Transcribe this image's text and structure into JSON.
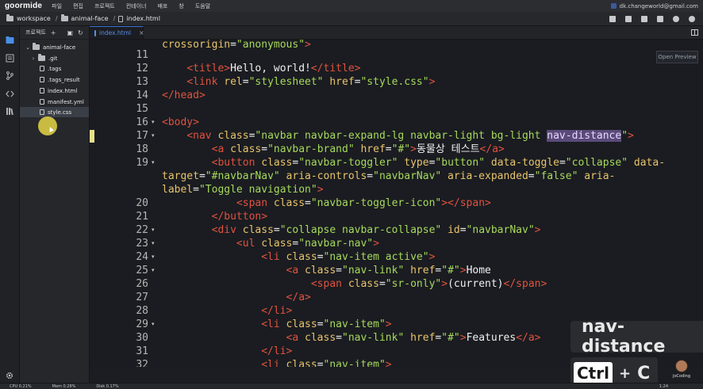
{
  "app": {
    "logo": "goormide",
    "menu": [
      "파일",
      "편집",
      "프로젝트",
      "컨테이너",
      "배포",
      "창",
      "도움말"
    ],
    "account": "dk.changeworld@gmail.com"
  },
  "breadcrumb": [
    "workspace",
    "animal-face",
    "index.html"
  ],
  "explorer": {
    "title": "프로젝트",
    "root": "animal-face",
    "items": [
      ".git",
      ".tags",
      ".tags_result",
      "index.html",
      "manifest.yml",
      "style.css"
    ],
    "selected": "style.css"
  },
  "editor": {
    "tab": "index.html",
    "preview_button": "Open Preview",
    "first_line_fragment": [
      {
        "c": "t-attr",
        "t": "crossorigin"
      },
      {
        "c": "t-text",
        "t": "="
      },
      {
        "c": "t-str",
        "t": "\"anonymous\""
      },
      {
        "c": "t-tag",
        "t": ">"
      }
    ],
    "lines": [
      {
        "n": "11",
        "fold": false,
        "tokens": []
      },
      {
        "n": "12",
        "fold": false,
        "tokens": [
          {
            "c": "t-text",
            "t": "    "
          },
          {
            "c": "t-tag",
            "t": "<title>"
          },
          {
            "c": "t-text",
            "t": "Hello, world!"
          },
          {
            "c": "t-tag",
            "t": "</title>"
          }
        ]
      },
      {
        "n": "13",
        "fold": false,
        "tokens": [
          {
            "c": "t-text",
            "t": "    "
          },
          {
            "c": "t-tag",
            "t": "<link "
          },
          {
            "c": "t-attr",
            "t": "rel"
          },
          {
            "c": "t-text",
            "t": "="
          },
          {
            "c": "t-str",
            "t": "\"stylesheet\""
          },
          {
            "c": "t-text",
            "t": " "
          },
          {
            "c": "t-attr",
            "t": "href"
          },
          {
            "c": "t-text",
            "t": "="
          },
          {
            "c": "t-str",
            "t": "\"style.css\""
          },
          {
            "c": "t-tag",
            "t": ">"
          }
        ]
      },
      {
        "n": "14",
        "fold": false,
        "tokens": [
          {
            "c": "t-tag",
            "t": "</head>"
          }
        ]
      },
      {
        "n": "15",
        "fold": false,
        "tokens": []
      },
      {
        "n": "16",
        "fold": true,
        "tokens": [
          {
            "c": "t-tag",
            "t": "<body>"
          }
        ]
      },
      {
        "n": "17",
        "fold": true,
        "tokens": [
          {
            "c": "t-text",
            "t": "    "
          },
          {
            "c": "t-tag",
            "t": "<nav "
          },
          {
            "c": "t-attr",
            "t": "class"
          },
          {
            "c": "t-text",
            "t": "="
          },
          {
            "c": "t-str",
            "t": "\"navbar navbar-expand-lg navbar-light bg-light "
          },
          {
            "c": "t-hl",
            "t": "nav-distance"
          },
          {
            "c": "t-str",
            "t": "\""
          },
          {
            "c": "t-tag",
            "t": ">"
          }
        ]
      },
      {
        "n": "18",
        "fold": false,
        "tokens": [
          {
            "c": "t-text",
            "t": "        "
          },
          {
            "c": "t-tag",
            "t": "<a "
          },
          {
            "c": "t-attr",
            "t": "class"
          },
          {
            "c": "t-text",
            "t": "="
          },
          {
            "c": "t-str",
            "t": "\"navbar-brand\""
          },
          {
            "c": "t-text",
            "t": " "
          },
          {
            "c": "t-attr",
            "t": "href"
          },
          {
            "c": "t-text",
            "t": "="
          },
          {
            "c": "t-str",
            "t": "\"#\""
          },
          {
            "c": "t-tag",
            "t": ">"
          },
          {
            "c": "t-text",
            "t": "동물상 테스트"
          },
          {
            "c": "t-tag",
            "t": "</a>"
          }
        ]
      },
      {
        "n": "19",
        "fold": true,
        "tokens": [
          {
            "c": "t-text",
            "t": "        "
          },
          {
            "c": "t-tag",
            "t": "<button "
          },
          {
            "c": "t-attr",
            "t": "class"
          },
          {
            "c": "t-text",
            "t": "="
          },
          {
            "c": "t-str",
            "t": "\"navbar-toggler\""
          },
          {
            "c": "t-text",
            "t": " "
          },
          {
            "c": "t-attr",
            "t": "type"
          },
          {
            "c": "t-text",
            "t": "="
          },
          {
            "c": "t-str",
            "t": "\"button\""
          },
          {
            "c": "t-text",
            "t": " "
          },
          {
            "c": "t-attr",
            "t": "data-toggle"
          },
          {
            "c": "t-text",
            "t": "="
          },
          {
            "c": "t-str",
            "t": "\"collapse\""
          },
          {
            "c": "t-text",
            "t": " "
          },
          {
            "c": "t-attr",
            "t": "data-"
          }
        ]
      },
      {
        "n": "",
        "fold": false,
        "tokens": [
          {
            "c": "t-attr",
            "t": "target"
          },
          {
            "c": "t-text",
            "t": "="
          },
          {
            "c": "t-str",
            "t": "\"#navbarNav\""
          },
          {
            "c": "t-text",
            "t": " "
          },
          {
            "c": "t-attr",
            "t": "aria-controls"
          },
          {
            "c": "t-text",
            "t": "="
          },
          {
            "c": "t-str",
            "t": "\"navbarNav\""
          },
          {
            "c": "t-text",
            "t": " "
          },
          {
            "c": "t-attr",
            "t": "aria-expanded"
          },
          {
            "c": "t-text",
            "t": "="
          },
          {
            "c": "t-str",
            "t": "\"false\""
          },
          {
            "c": "t-text",
            "t": " "
          },
          {
            "c": "t-attr",
            "t": "aria-"
          }
        ]
      },
      {
        "n": "",
        "fold": false,
        "tokens": [
          {
            "c": "t-attr",
            "t": "label"
          },
          {
            "c": "t-text",
            "t": "="
          },
          {
            "c": "t-str",
            "t": "\"Toggle navigation\""
          },
          {
            "c": "t-tag",
            "t": ">"
          }
        ]
      },
      {
        "n": "20",
        "fold": false,
        "tokens": [
          {
            "c": "t-text",
            "t": "            "
          },
          {
            "c": "t-tag",
            "t": "<span "
          },
          {
            "c": "t-attr",
            "t": "class"
          },
          {
            "c": "t-text",
            "t": "="
          },
          {
            "c": "t-str",
            "t": "\"navbar-toggler-icon\""
          },
          {
            "c": "t-tag",
            "t": "></span>"
          }
        ]
      },
      {
        "n": "21",
        "fold": false,
        "tokens": [
          {
            "c": "t-text",
            "t": "        "
          },
          {
            "c": "t-tag",
            "t": "</button>"
          }
        ]
      },
      {
        "n": "22",
        "fold": true,
        "tokens": [
          {
            "c": "t-text",
            "t": "        "
          },
          {
            "c": "t-tag",
            "t": "<div "
          },
          {
            "c": "t-attr",
            "t": "class"
          },
          {
            "c": "t-text",
            "t": "="
          },
          {
            "c": "t-str",
            "t": "\"collapse navbar-collapse\""
          },
          {
            "c": "t-text",
            "t": " "
          },
          {
            "c": "t-attr",
            "t": "id"
          },
          {
            "c": "t-text",
            "t": "="
          },
          {
            "c": "t-str",
            "t": "\"navbarNav\""
          },
          {
            "c": "t-tag",
            "t": ">"
          }
        ]
      },
      {
        "n": "23",
        "fold": true,
        "tokens": [
          {
            "c": "t-text",
            "t": "            "
          },
          {
            "c": "t-tag",
            "t": "<ul "
          },
          {
            "c": "t-attr",
            "t": "class"
          },
          {
            "c": "t-text",
            "t": "="
          },
          {
            "c": "t-str",
            "t": "\"navbar-nav\""
          },
          {
            "c": "t-tag",
            "t": ">"
          }
        ]
      },
      {
        "n": "24",
        "fold": true,
        "tokens": [
          {
            "c": "t-text",
            "t": "                "
          },
          {
            "c": "t-tag",
            "t": "<li "
          },
          {
            "c": "t-attr",
            "t": "class"
          },
          {
            "c": "t-text",
            "t": "="
          },
          {
            "c": "t-str",
            "t": "\"nav-item active\""
          },
          {
            "c": "t-tag",
            "t": ">"
          }
        ]
      },
      {
        "n": "25",
        "fold": true,
        "tokens": [
          {
            "c": "t-text",
            "t": "                    "
          },
          {
            "c": "t-tag",
            "t": "<a "
          },
          {
            "c": "t-attr",
            "t": "class"
          },
          {
            "c": "t-text",
            "t": "="
          },
          {
            "c": "t-str",
            "t": "\"nav-link\""
          },
          {
            "c": "t-text",
            "t": " "
          },
          {
            "c": "t-attr",
            "t": "href"
          },
          {
            "c": "t-text",
            "t": "="
          },
          {
            "c": "t-str",
            "t": "\"#\""
          },
          {
            "c": "t-tag",
            "t": ">"
          },
          {
            "c": "t-text",
            "t": "Home"
          }
        ]
      },
      {
        "n": "26",
        "fold": false,
        "tokens": [
          {
            "c": "t-text",
            "t": "                        "
          },
          {
            "c": "t-tag",
            "t": "<span "
          },
          {
            "c": "t-attr",
            "t": "class"
          },
          {
            "c": "t-text",
            "t": "="
          },
          {
            "c": "t-str",
            "t": "\"sr-only\""
          },
          {
            "c": "t-tag",
            "t": ">"
          },
          {
            "c": "t-text",
            "t": "(current)"
          },
          {
            "c": "t-tag",
            "t": "</span>"
          }
        ]
      },
      {
        "n": "27",
        "fold": false,
        "tokens": [
          {
            "c": "t-text",
            "t": "                    "
          },
          {
            "c": "t-tag",
            "t": "</a>"
          }
        ]
      },
      {
        "n": "28",
        "fold": false,
        "tokens": [
          {
            "c": "t-text",
            "t": "                "
          },
          {
            "c": "t-tag",
            "t": "</li>"
          }
        ]
      },
      {
        "n": "29",
        "fold": true,
        "tokens": [
          {
            "c": "t-text",
            "t": "                "
          },
          {
            "c": "t-tag",
            "t": "<li "
          },
          {
            "c": "t-attr",
            "t": "class"
          },
          {
            "c": "t-text",
            "t": "="
          },
          {
            "c": "t-str",
            "t": "\"nav-item\""
          },
          {
            "c": "t-tag",
            "t": ">"
          }
        ]
      },
      {
        "n": "30",
        "fold": false,
        "tokens": [
          {
            "c": "t-text",
            "t": "                    "
          },
          {
            "c": "t-tag",
            "t": "<a "
          },
          {
            "c": "t-attr",
            "t": "class"
          },
          {
            "c": "t-text",
            "t": "="
          },
          {
            "c": "t-str",
            "t": "\"nav-link\""
          },
          {
            "c": "t-text",
            "t": " "
          },
          {
            "c": "t-attr",
            "t": "href"
          },
          {
            "c": "t-text",
            "t": "="
          },
          {
            "c": "t-str",
            "t": "\"#\""
          },
          {
            "c": "t-tag",
            "t": ">"
          },
          {
            "c": "t-text",
            "t": "Features"
          },
          {
            "c": "t-tag",
            "t": "</a>"
          }
        ]
      },
      {
        "n": "31",
        "fold": false,
        "tokens": [
          {
            "c": "t-text",
            "t": "                "
          },
          {
            "c": "t-tag",
            "t": "</li>"
          }
        ]
      },
      {
        "n": "32",
        "fold": false,
        "tokens": [
          {
            "c": "t-text",
            "t": "                "
          },
          {
            "c": "t-tag",
            "t": "<li "
          },
          {
            "c": "t-attr",
            "t": "class"
          },
          {
            "c": "t-text",
            "t": "="
          },
          {
            "c": "t-str",
            "t": "\"nav-item\""
          },
          {
            "c": "t-tag",
            "t": ">"
          }
        ]
      }
    ]
  },
  "overlay": {
    "copied_text": "nav-distance",
    "key_ctrl": "Ctrl",
    "key_plus": "+",
    "key_c": "C",
    "channel": "JoCoding"
  },
  "status": {
    "cpu": "CPU 0.21%",
    "mem": "Mem 0.28%",
    "disk": "Disk 0.17%",
    "position": "1:24"
  }
}
